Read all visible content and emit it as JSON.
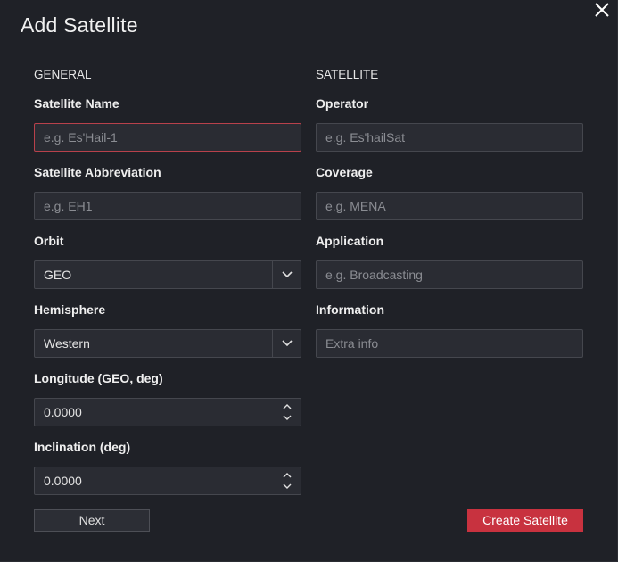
{
  "dialog": {
    "title": "Add Satellite",
    "close_icon": "close-icon"
  },
  "general": {
    "heading": "GENERAL",
    "satellite_name": {
      "label": "Satellite Name",
      "placeholder": "e.g. Es'Hail-1",
      "value": ""
    },
    "satellite_abbreviation": {
      "label": "Satellite Abbreviation",
      "placeholder": "e.g. EH1",
      "value": ""
    },
    "orbit": {
      "label": "Orbit",
      "selected": "GEO"
    },
    "hemisphere": {
      "label": "Hemisphere",
      "selected": "Western"
    },
    "longitude": {
      "label": "Longitude (GEO, deg)",
      "value": "0.0000"
    },
    "inclination": {
      "label": "Inclination (deg)",
      "value": "0.0000"
    }
  },
  "satellite": {
    "heading": "SATELLITE",
    "operator": {
      "label": "Operator",
      "placeholder": "e.g. Es'hailSat",
      "value": ""
    },
    "coverage": {
      "label": "Coverage",
      "placeholder": "e.g. MENA",
      "value": ""
    },
    "application": {
      "label": "Application",
      "placeholder": "e.g. Broadcasting",
      "value": ""
    },
    "information": {
      "label": "Information",
      "placeholder": "Extra info",
      "value": ""
    }
  },
  "buttons": {
    "next": "Next",
    "create": "Create Satellite"
  },
  "colors": {
    "background": "#1f2127",
    "accent": "#c8323f",
    "field_bg": "#2a2c33",
    "field_border": "#45474e"
  }
}
